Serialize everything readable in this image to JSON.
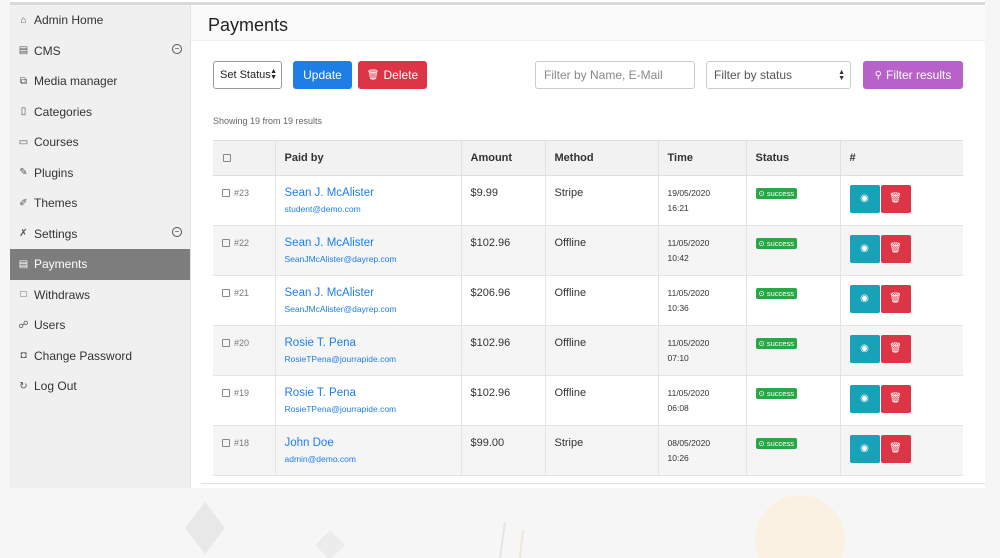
{
  "sidebar": {
    "items": [
      {
        "label": "Admin Home",
        "icon": "home-icon",
        "glyph": "⌂"
      },
      {
        "label": "CMS",
        "icon": "cms-icon",
        "glyph": "▤",
        "toggle": "−"
      },
      {
        "label": "Media manager",
        "icon": "media-icon",
        "glyph": "⧉"
      },
      {
        "label": "Categories",
        "icon": "categories-icon",
        "glyph": "▯"
      },
      {
        "label": "Courses",
        "icon": "courses-icon",
        "glyph": "▭"
      },
      {
        "label": "Plugins",
        "icon": "plug-icon",
        "glyph": "✎"
      },
      {
        "label": "Themes",
        "icon": "brush-icon",
        "glyph": "✐"
      },
      {
        "label": "Settings",
        "icon": "tools-icon",
        "glyph": "✗",
        "toggle": "−"
      },
      {
        "label": "Payments",
        "icon": "invoice-icon",
        "glyph": "▤",
        "active": true
      },
      {
        "label": "Withdraws",
        "icon": "withdraw-icon",
        "glyph": "□"
      },
      {
        "label": "Users",
        "icon": "users-icon",
        "glyph": "☍"
      },
      {
        "label": "Change Password",
        "icon": "lock-icon",
        "glyph": "◘"
      },
      {
        "label": "Log Out",
        "icon": "logout-icon",
        "glyph": "↻"
      }
    ]
  },
  "header": {
    "title": "Payments"
  },
  "toolbar": {
    "set_status_label": "Set Status",
    "update_label": "Update",
    "delete_label": "Delete",
    "filter_name_placeholder": "Filter by Name, E-Mail",
    "filter_status_label": "Filter by status",
    "filter_results_label": "Filter results"
  },
  "showing_text": "Showing 19 from 19 results",
  "table": {
    "headers": [
      "",
      "Paid by",
      "Amount",
      "Method",
      "Time",
      "Status",
      "#"
    ],
    "rows": [
      {
        "id": "#23",
        "name": "Sean J. McAlister",
        "email": "student@demo.com",
        "amount": "$9.99",
        "method": "Stripe",
        "date": "19/05/2020",
        "time": "16:21",
        "status": "success"
      },
      {
        "id": "#22",
        "name": "Sean J. McAlister",
        "email": "SeanJMcAlister@dayrep.com",
        "amount": "$102.96",
        "method": "Offline",
        "date": "11/05/2020",
        "time": "10:42",
        "status": "success"
      },
      {
        "id": "#21",
        "name": "Sean J. McAlister",
        "email": "SeanJMcAlister@dayrep.com",
        "amount": "$206.96",
        "method": "Offline",
        "date": "11/05/2020",
        "time": "10:36",
        "status": "success"
      },
      {
        "id": "#20",
        "name": "Rosie T. Pena",
        "email": "RosieTPena@jourrapide.com",
        "amount": "$102.96",
        "method": "Offline",
        "date": "11/05/2020",
        "time": "07:10",
        "status": "success"
      },
      {
        "id": "#19",
        "name": "Rosie T. Pena",
        "email": "RosieTPena@jourrapide.com",
        "amount": "$102.96",
        "method": "Offline",
        "date": "11/05/2020",
        "time": "06:08",
        "status": "success"
      },
      {
        "id": "#18",
        "name": "John Doe",
        "email": "admin@demo.com",
        "amount": "$99.00",
        "method": "Stripe",
        "date": "08/05/2020",
        "time": "10:26",
        "status": "success"
      }
    ]
  },
  "colors": {
    "primary": "#1f7ee6",
    "danger": "#dc3545",
    "info": "#17a2b8",
    "success": "#28a745",
    "filter": "#b762c8",
    "active_sidebar": "#7d7d7d"
  }
}
